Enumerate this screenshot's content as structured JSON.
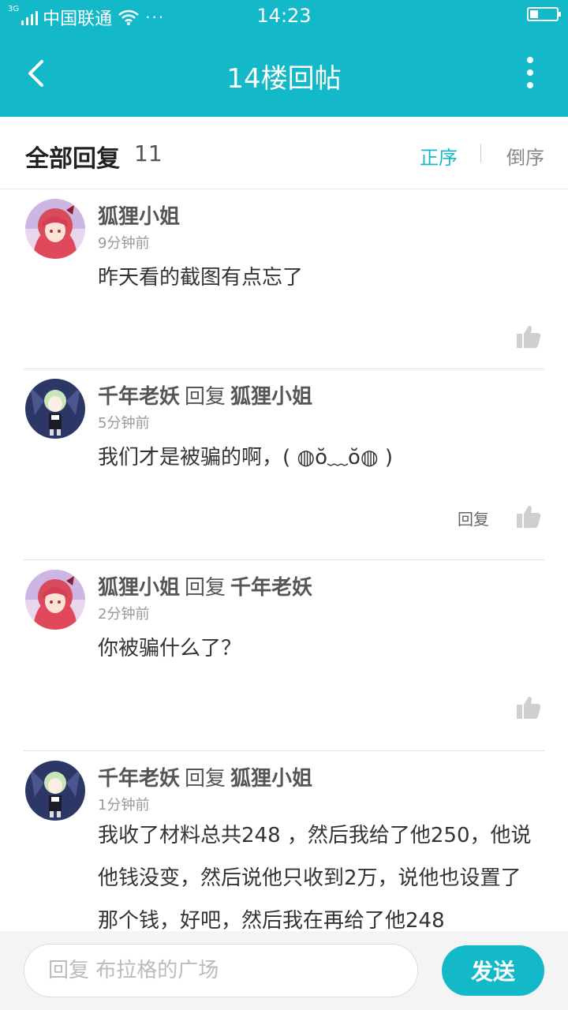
{
  "status_bar": {
    "network": "3G",
    "carrier": "中国联通",
    "more": "···",
    "time": "14:23"
  },
  "header": {
    "title": "14楼回帖"
  },
  "sort_bar": {
    "title": "全部回复",
    "count": "11",
    "ascending": "正序",
    "descending": "倒序"
  },
  "replies": [
    {
      "author": "狐狸小姐",
      "reply_word": "",
      "target": "",
      "time": "9分钟前",
      "content": "昨天看的截图有点忘了",
      "reply_label": "",
      "avatar": "avatar-red-hair"
    },
    {
      "author": "千年老妖",
      "reply_word": "回复",
      "target": "狐狸小姐",
      "time": "5分钟前",
      "content": "我们才是被骗的啊，( ◍ŏ﹏ŏ◍ )",
      "reply_label": "回复",
      "avatar": "avatar-green-hair"
    },
    {
      "author": "狐狸小姐",
      "reply_word": "回复",
      "target": "千年老妖",
      "time": "2分钟前",
      "content": "你被骗什么了？",
      "reply_label": "",
      "avatar": "avatar-red-hair"
    },
    {
      "author": "千年老妖",
      "reply_word": "回复",
      "target": "狐狸小姐",
      "time": "1分钟前",
      "content": "我收了材料总共248 ，然后我给了他250，他说他钱没变，然后说他只收到2万，说他也设置了那个钱，好吧，然后我在再给了他248",
      "reply_label": "",
      "avatar": "avatar-green-hair"
    }
  ],
  "composer": {
    "placeholder": "回复 布拉格的广场",
    "send_label": "发送"
  },
  "colors": {
    "accent": "#14b9c9",
    "header_bg": "#14b9c9"
  }
}
